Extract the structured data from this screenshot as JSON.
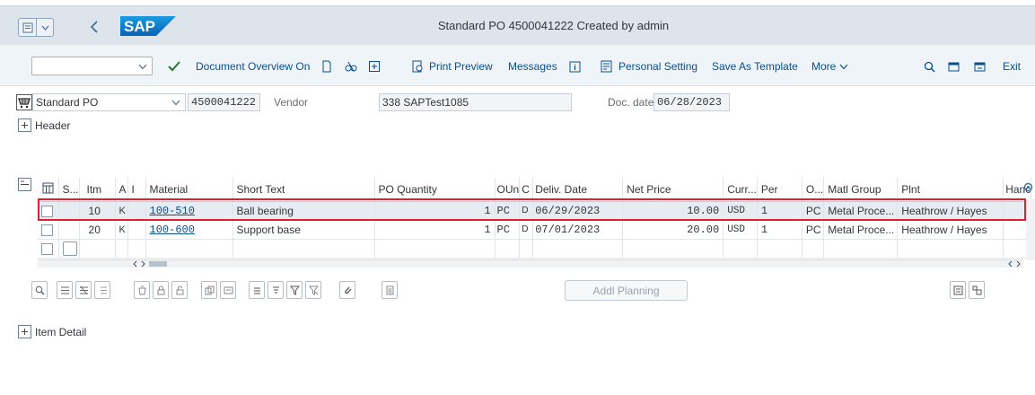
{
  "window": {
    "title": "Standard PO 4500041222 Created by admin",
    "logo_text": "SAP"
  },
  "toolbar": {
    "command_value": "",
    "document_overview": "Document Overview On",
    "print_preview": "Print Preview",
    "messages": "Messages",
    "personal_setting": "Personal Setting",
    "save_as_template": "Save As Template",
    "more": "More",
    "exit": "Exit"
  },
  "header": {
    "doc_type": "Standard PO",
    "po_number": "4500041222",
    "vendor_label": "Vendor",
    "vendor_value": "338 SAPTest1085",
    "doc_date_label": "Doc. date",
    "doc_date_value": "06/28/2023",
    "header_section": "Header"
  },
  "items_table": {
    "columns": [
      "S...",
      "Itm",
      "A",
      "I",
      "Material",
      "Short Text",
      "PO Quantity",
      "OUn",
      "C",
      "Deliv. Date",
      "Net Price",
      "Curr...",
      "Per",
      "O...",
      "Matl Group",
      "Plnt",
      "Hanc"
    ],
    "rows": [
      {
        "itm": "10",
        "a": "K",
        "material": "100-510",
        "short_text": "Ball bearing",
        "qty": "1",
        "oun": "PC",
        "c": "D",
        "deliv_date": "06/29/2023",
        "net_price": "10.00",
        "curr": "USD",
        "per": "1",
        "o": "PC",
        "matl_group": "Metal Proce...",
        "plant": "Heathrow / Hayes"
      },
      {
        "itm": "20",
        "a": "K",
        "material": "100-600",
        "short_text": "Support base",
        "qty": "1",
        "oun": "PC",
        "c": "D",
        "deliv_date": "07/01/2023",
        "net_price": "20.00",
        "curr": "USD",
        "per": "1",
        "o": "PC",
        "matl_group": "Metal Proce...",
        "plant": "Heathrow / Hayes"
      }
    ]
  },
  "bottom": {
    "addl_planning": "Addl Planning",
    "item_detail": "Item Detail"
  },
  "colors": {
    "accent": "#0a4e8c",
    "highlight": "#e02030",
    "titlebar": "#dde4ec"
  }
}
